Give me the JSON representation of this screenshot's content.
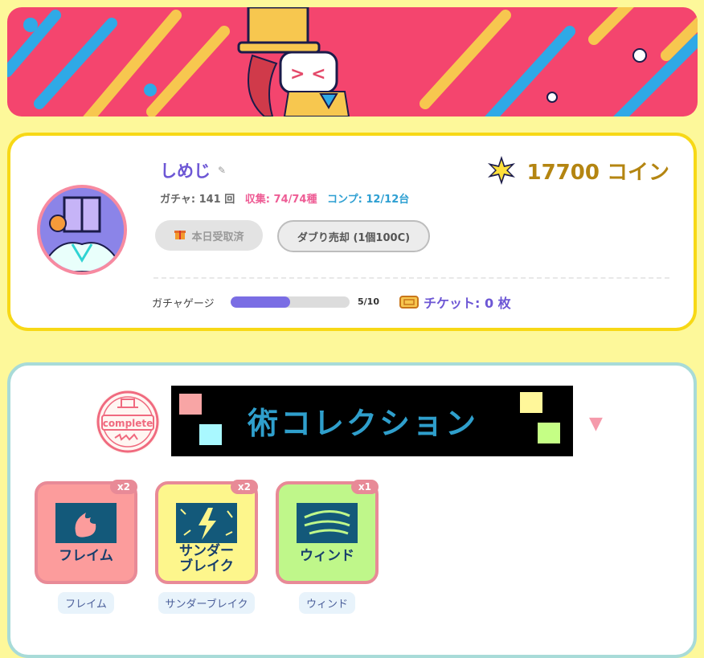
{
  "profile": {
    "username": "しめじ",
    "edit_icon": "pencil-icon",
    "stats": {
      "gacha": "ガチャ: 141 回",
      "collected": "収集: 74/74種",
      "complete": "コンプ: 12/12台"
    },
    "coins": "17700 コイン",
    "claim_button": "本日受取済",
    "sell_button": "ダブり売却 (1個100C)",
    "gauge_label": "ガチャゲージ",
    "gauge_value": 0.5,
    "gauge_count": "5/10",
    "tickets": "チケット: 0 枚"
  },
  "collection": {
    "stamp_text": "complete",
    "title": "術コレクション",
    "toggle_icon": "triangle-down-icon",
    "items": [
      {
        "badge": "x2",
        "art_text": "フレイム",
        "name": "フレイム",
        "color": "#fc9c9c"
      },
      {
        "badge": "x2",
        "art_text": "サンダー\nブレイク",
        "name": "サンダーブレイク",
        "color": "#fdf68c"
      },
      {
        "badge": "x1",
        "art_text": "ウィンド",
        "name": "ウィンド",
        "color": "#bff78a"
      }
    ]
  },
  "colors": {
    "banner": "#f4456e",
    "profile_border": "#f7d816",
    "collection_border": "#a8dbd8",
    "accent_purple": "#6d57d5",
    "coin_gold": "#b48511"
  }
}
